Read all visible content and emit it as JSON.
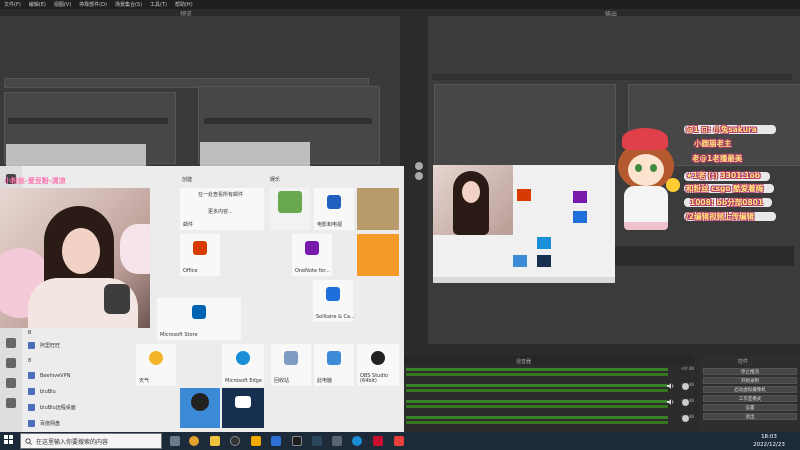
{
  "menu": [
    "文件(F)",
    "编辑(E)",
    "视图(V)",
    "停靠部件(D)",
    "场景集合(S)",
    "工具(T)",
    "帮助(H)"
  ],
  "panels": {
    "preview": "预览",
    "program": "输出"
  },
  "overlay": {
    "left_banner": "小粉丝-爱豆粉-清凉",
    "right_lines": [
      "@1 ⊡: 小兔sakura",
      "小圆猫老主",
      "老@1老播最美",
      "★1老 (:) 3301:1ob",
      "和粉丝 csgo 酷爱着嗨",
      "1008: bb分部0801",
      "/2编辑视频上传编辑"
    ]
  },
  "start_menu": {
    "rail_letters": [
      "8",
      "B"
    ],
    "groups": {
      "create": "创建",
      "play": "娱乐"
    },
    "create_tile_header": "在一处查看所有邮件",
    "create_tile_sub": "更多内容...",
    "mail_label": "邮件",
    "apps": [
      "阿里旺旺",
      "BeehiveVPN",
      "bluBlu",
      "bluBlu远程桌面",
      "百度网盘"
    ],
    "tiles": [
      {
        "label": "Office",
        "color": "#d83b01"
      },
      {
        "label": "OneNote for...",
        "color": "#7719aa"
      },
      {
        "label": "Solitaire & Ca...",
        "color": "#1e6fd9"
      },
      {
        "label": "Microsoft Store",
        "color": "#0063b1"
      },
      {
        "label": "天气",
        "color": "#f5b52b"
      },
      {
        "label": "Microsoft Edge",
        "color": "#1a8fd8"
      },
      {
        "label": "回收站",
        "color": "#7c9cc4"
      },
      {
        "label": "此电脑",
        "color": "#3c8bd9"
      },
      {
        "label": "OBS Studio (64bit)",
        "color": "#222222"
      },
      {
        "label": "电影和电视",
        "color": "#1f5fbf"
      }
    ]
  },
  "mixer": {
    "title": "混音器",
    "db_label": "-Inf dB"
  },
  "controls": {
    "title": "控件",
    "buttons": [
      "停止推流",
      "开始录制",
      "启动虚拟摄像机",
      "工作室模式",
      "设置",
      "退出"
    ]
  },
  "taskbar": {
    "search_placeholder": "在这里输入你要搜索的内容",
    "time": "18:03",
    "date": "2022/12/23"
  }
}
